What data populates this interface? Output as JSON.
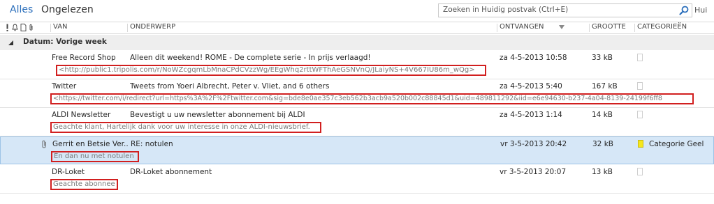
{
  "topbar": {
    "filter_all": "Alles",
    "filter_unread": "Ongelezen",
    "search_placeholder": "Zoeken in Huidig postvak (Ctrl+E)",
    "scope_label": "Hui"
  },
  "columns": {
    "from": "VAN",
    "subject": "ONDERWERP",
    "received": "ONTVANGEN",
    "size": "GROOTTE",
    "categories": "CATEGORIEËN"
  },
  "group": {
    "label": "Datum: Vorige week"
  },
  "colors": {
    "accent": "#2a6ebb",
    "highlight_border": "#d11f1f",
    "selected_row": "#d6e7f7",
    "category_yellow": "#f6e71d"
  },
  "messages": [
    {
      "from": "Free Record Shop",
      "subject": "Alleen dit weekend! ROME - De complete serie - In prijs verlaagd!",
      "preview": "<http://public1.tripolis.com/r/NoWZcgqmLbMnaCPdCVzzWg/EEgWhq2rttWFThAeGSNVnQ/JLaiyNS+4V667IU86m_wQg>",
      "received": "za 4-5-2013 10:58",
      "size": "33 kB",
      "category": ""
    },
    {
      "from": "Twitter",
      "subject": "Tweets from Yoeri Albrecht, Peter v. Vliet, and 6 others",
      "preview": "<https://twitter.com/i/redirect?url=https%3A%2F%2Ftwitter.com&sig=bde8e0ae357c3eb562b3acb9a520b002c88845d1&uid=489811292&iid=e6e94630-b237-4a04-8139-24199f6ff8",
      "received": "za 4-5-2013 5:40",
      "size": "167 kB",
      "category": ""
    },
    {
      "from": "ALDI Newsletter",
      "subject": "Bevestigt u uw newsletter abonnement bij ALDI",
      "preview": "Geachte klant,  Hartelijk dank voor uw interesse in onze ALDI-nieuwsbrief.",
      "received": "za 4-5-2013 1:14",
      "size": "14 kB",
      "category": ""
    },
    {
      "from": "Gerrit en Betsie Ver...",
      "subject": "RE: notulen",
      "preview": "En dan nu met notulen",
      "received": "vr 3-5-2013 20:42",
      "size": "32 kB",
      "category": "Categorie Geel"
    },
    {
      "from": "DR-Loket",
      "subject": "DR-Loket abonnement",
      "preview": "Geachte abonnee",
      "received": "vr 3-5-2013 20:07",
      "size": "13 kB",
      "category": ""
    }
  ]
}
